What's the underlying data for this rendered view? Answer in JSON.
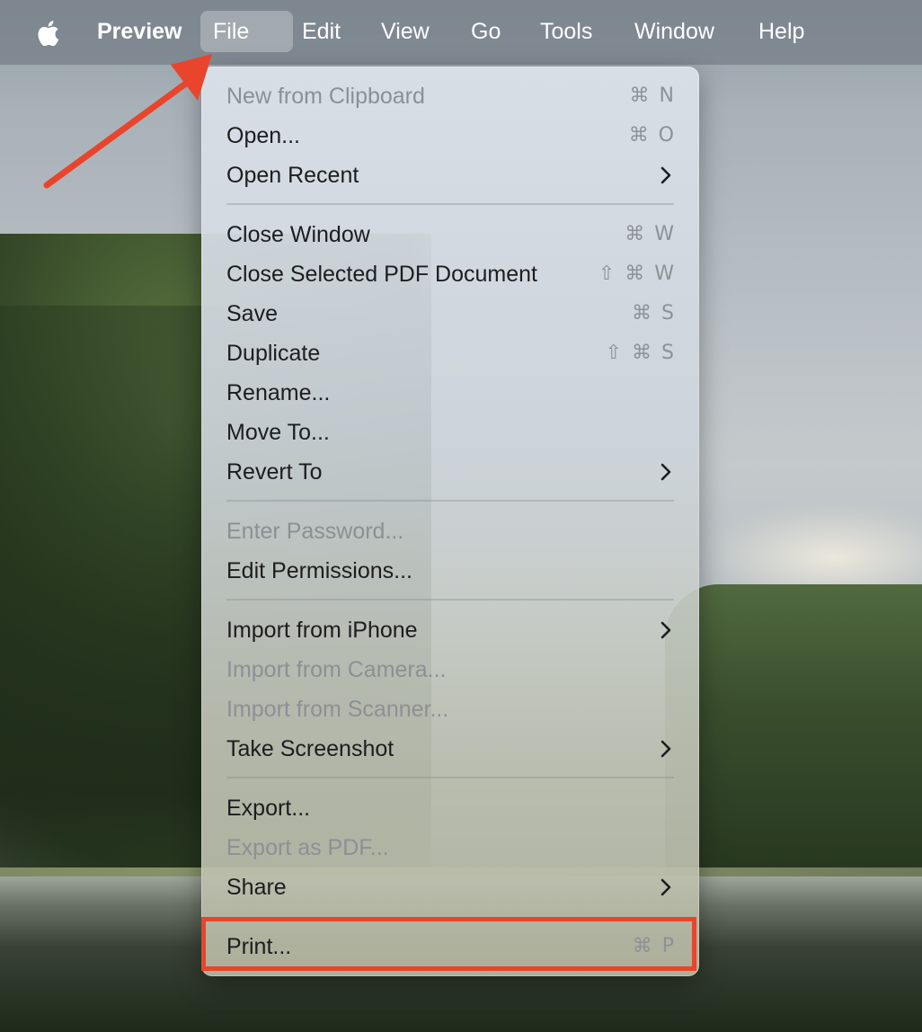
{
  "menubar": {
    "app_name": "Preview",
    "items": [
      "File",
      "Edit",
      "View",
      "Go",
      "Tools",
      "Window",
      "Help"
    ],
    "active": "File"
  },
  "file_menu": {
    "items": [
      {
        "label": "New from Clipboard",
        "shortcut": "⌘ N",
        "disabled": true
      },
      {
        "label": "Open...",
        "shortcut": "⌘ O"
      },
      {
        "label": "Open Recent",
        "submenu": true
      },
      {
        "label": "Close Window",
        "shortcut": "⌘ W"
      },
      {
        "label": "Close Selected PDF Document",
        "shortcut": "⇧ ⌘ W"
      },
      {
        "label": "Save",
        "shortcut": "⌘ S"
      },
      {
        "label": "Duplicate",
        "shortcut": "⇧ ⌘ S"
      },
      {
        "label": "Rename..."
      },
      {
        "label": "Move To..."
      },
      {
        "label": "Revert To",
        "submenu": true
      },
      {
        "label": "Enter Password...",
        "disabled": true
      },
      {
        "label": "Edit Permissions..."
      },
      {
        "label": "Import from iPhone",
        "submenu": true
      },
      {
        "label": "Import from Camera...",
        "disabled": true
      },
      {
        "label": "Import from Scanner...",
        "disabled": true
      },
      {
        "label": "Take Screenshot",
        "submenu": true
      },
      {
        "label": "Export..."
      },
      {
        "label": "Export as PDF...",
        "disabled": true
      },
      {
        "label": "Share",
        "submenu": true
      },
      {
        "label": "Print...",
        "shortcut": "⌘ P",
        "highlighted": true
      }
    ]
  },
  "annotation": {
    "arrow_color": "#e8452c",
    "highlight_color": "#e8452c"
  }
}
